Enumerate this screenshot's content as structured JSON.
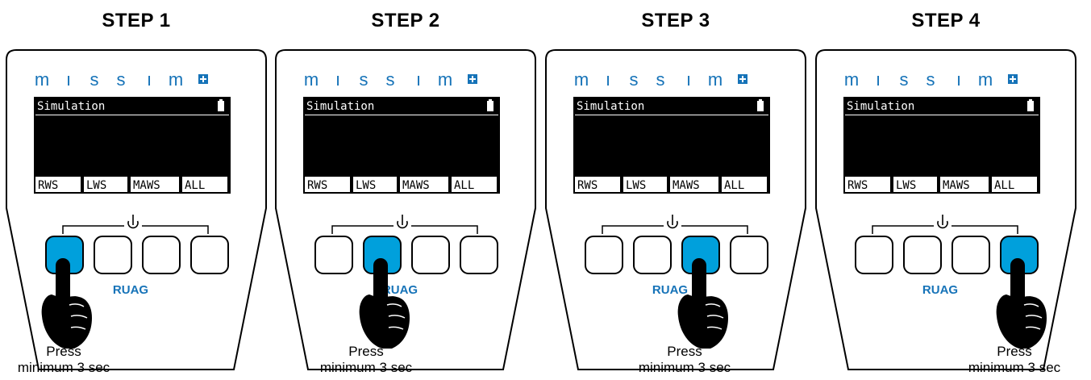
{
  "colors": {
    "accent": "#00a0dc",
    "brand": "#1673b8",
    "screen": "#000000"
  },
  "brand_letters": [
    "m",
    "ı",
    "s",
    "s",
    "ı",
    "m"
  ],
  "brand_plus_icon": "plus-box-icon",
  "power_icon": "power-icon",
  "screen_title": "Simulation",
  "battery_icon": "battery-icon",
  "softkeys": [
    "RWS",
    "LWS",
    "MAWS",
    "ALL"
  ],
  "logo": "RUAG",
  "pointer_icon": "hand-pointer-icon",
  "steps": [
    {
      "title": "STEP 1",
      "active_button": 1,
      "caption_line1": "Press",
      "caption_line2": "minimum 3 sec"
    },
    {
      "title": "STEP 2",
      "active_button": 2,
      "caption_line1": "Press",
      "caption_line2": "minimum 3 sec"
    },
    {
      "title": "STEP 3",
      "active_button": 3,
      "caption_line1": "Press",
      "caption_line2": "minimum 3 sec"
    },
    {
      "title": "STEP 4",
      "active_button": 4,
      "caption_line1": "Press",
      "caption_line2": "minimum 3 sec"
    }
  ]
}
